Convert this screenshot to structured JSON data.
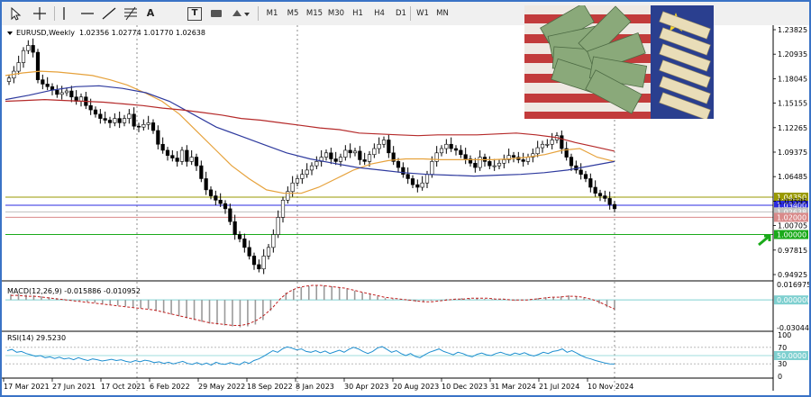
{
  "toolbar": {
    "tools": [
      "cursor",
      "crosshair",
      "vertical-line",
      "horizontal-line",
      "trendline",
      "fibonacci",
      "text",
      "label",
      "rectangle",
      "shapes"
    ],
    "text_tool_label": "A",
    "label_tool_label": "T",
    "timeframes": [
      "M1",
      "M5",
      "M15",
      "M30",
      "H1",
      "H4",
      "D1",
      "W1",
      "MN"
    ]
  },
  "chart_data": {
    "type": "candlestick",
    "symbol_header": "EURUSD,Weekly",
    "ohlc_header": "1.02356 1.02774 1.01770 1.02638",
    "price_axis_ticks": [
      "1.23825",
      "1.20935",
      "1.18045",
      "1.15155",
      "1.12265",
      "1.09375",
      "1.06485",
      "1.03595",
      "1.00705",
      "0.97815",
      "0.94925"
    ],
    "price_range": [
      0.94925,
      1.23825
    ],
    "time_axis_labels": [
      "17 Mar 2021",
      "27 Jun 2021",
      "17 Oct 2021",
      "6 Feb 2022",
      "29 May 2022",
      "18 Sep 2022",
      "8 Jan 2023",
      "30 Apr 2023",
      "20 Aug 2023",
      "10 Dec 2023",
      "31 Mar 2024",
      "21 Jul 2024",
      "10 Nov 2024"
    ],
    "price_levels": [
      {
        "label": "1.04350",
        "value": 1.0435,
        "color": "#9a9a00"
      },
      {
        "label": "1.03400",
        "value": 1.034,
        "color": "#2b2be0"
      },
      {
        "label": "1.02638",
        "value": 1.02638,
        "color": "#c0c0c0"
      },
      {
        "label": "1.02000",
        "value": 1.02,
        "color": "#d98a8a"
      },
      {
        "label": "1.00000",
        "value": 1.0,
        "color": "#1aaa1a"
      }
    ],
    "moving_averages": [
      {
        "color": "#e6a23c",
        "values": [
          1.185,
          1.188,
          1.19,
          1.189,
          1.187,
          1.185,
          1.18,
          1.174,
          1.165,
          1.155,
          1.14,
          1.12,
          1.1,
          1.08,
          1.065,
          1.052,
          1.048,
          1.048,
          1.055,
          1.065,
          1.075,
          1.082,
          1.086,
          1.088,
          1.088,
          1.087,
          1.087,
          1.087,
          1.087,
          1.088,
          1.09,
          1.093,
          1.098,
          1.1,
          1.09,
          1.085
        ]
      },
      {
        "color": "#2e3a9e",
        "values": [
          1.157,
          1.162,
          1.168,
          1.172,
          1.173,
          1.17,
          1.165,
          1.155,
          1.14,
          1.125,
          1.115,
          1.105,
          1.095,
          1.088,
          1.083,
          1.078,
          1.075,
          1.072,
          1.07,
          1.069,
          1.068,
          1.069,
          1.07,
          1.072,
          1.075,
          1.08,
          1.085
        ]
      },
      {
        "color": "#b52a2a",
        "values": [
          1.155,
          1.156,
          1.157,
          1.156,
          1.155,
          1.154,
          1.152,
          1.15,
          1.147,
          1.145,
          1.142,
          1.139,
          1.135,
          1.133,
          1.13,
          1.127,
          1.124,
          1.122,
          1.118,
          1.117,
          1.116,
          1.115,
          1.116,
          1.116,
          1.116,
          1.117,
          1.118,
          1.116,
          1.113,
          1.107,
          1.102,
          1.097
        ]
      }
    ],
    "closes": [
      1.182,
      1.19,
      1.2,
      1.214,
      1.22,
      1.212,
      1.18,
      1.175,
      1.172,
      1.168,
      1.163,
      1.165,
      1.167,
      1.16,
      1.155,
      1.16,
      1.15,
      1.145,
      1.14,
      1.135,
      1.133,
      1.13,
      1.135,
      1.13,
      1.135,
      1.14,
      1.126,
      1.125,
      1.128,
      1.13,
      1.121,
      1.105,
      1.098,
      1.092,
      1.089,
      1.085,
      1.098,
      1.085,
      1.09,
      1.08,
      1.065,
      1.052,
      1.045,
      1.04,
      1.036,
      1.03,
      1.015,
      1.0,
      0.995,
      0.985,
      0.975,
      0.965,
      0.96,
      0.975,
      0.985,
      1.0,
      1.02,
      1.04,
      1.05,
      1.06,
      1.065,
      1.07,
      1.075,
      1.08,
      1.085,
      1.09,
      1.095,
      1.088,
      1.085,
      1.09,
      1.098,
      1.095,
      1.097,
      1.087,
      1.085,
      1.093,
      1.1,
      1.105,
      1.11,
      1.095,
      1.085,
      1.078,
      1.07,
      1.065,
      1.058,
      1.055,
      1.06,
      1.07,
      1.085,
      1.095,
      1.1,
      1.105,
      1.1,
      1.098,
      1.093,
      1.088,
      1.083,
      1.078,
      1.09,
      1.085,
      1.08,
      1.08,
      1.083,
      1.087,
      1.092,
      1.09,
      1.087,
      1.085,
      1.09,
      1.094,
      1.101,
      1.105,
      1.105,
      1.11,
      1.115,
      1.1,
      1.09,
      1.08,
      1.075,
      1.07,
      1.065,
      1.055,
      1.048,
      1.045,
      1.042,
      1.035,
      1.03
    ],
    "macd": {
      "label": "MACD(12,26,9) -0.015886 -0.010952",
      "ticks": [
        "0.016975",
        "0.000000",
        "-0.030447"
      ],
      "range": [
        -0.030447,
        0.016975
      ],
      "histogram": [
        0.006,
        0.007,
        0.006,
        0.005,
        0.004,
        0.003,
        0.002,
        0.001,
        0.0,
        -0.001,
        -0.002,
        -0.003,
        -0.004,
        -0.005,
        -0.006,
        -0.007,
        -0.008,
        -0.009,
        -0.01,
        -0.012,
        -0.014,
        -0.016,
        -0.018,
        -0.02,
        -0.022,
        -0.024,
        -0.026,
        -0.027,
        -0.028,
        -0.029,
        -0.03,
        -0.029,
        -0.027,
        -0.022,
        -0.012,
        0.0,
        0.008,
        0.012,
        0.014,
        0.015,
        0.016,
        0.016,
        0.015,
        0.014,
        0.012,
        0.01,
        0.008,
        0.006,
        0.004,
        0.002,
        0.001,
        0.0,
        -0.001,
        -0.002,
        -0.002,
        -0.001,
        0.0,
        0.001,
        0.001,
        0.002,
        0.002,
        0.002,
        0.001,
        0.001,
        0.0,
        0.0,
        -0.001,
        0.0,
        0.001,
        0.002,
        0.003,
        0.003,
        0.004,
        0.005,
        0.004,
        0.002,
        0.0,
        -0.004,
        -0.008,
        -0.011
      ],
      "signal": [
        0.005,
        0.005,
        0.004,
        0.004,
        0.003,
        0.002,
        0.001,
        0.0,
        -0.001,
        -0.002,
        -0.003,
        -0.004,
        -0.005,
        -0.006,
        -0.007,
        -0.008,
        -0.009,
        -0.01,
        -0.011,
        -0.013,
        -0.015,
        -0.017,
        -0.019,
        -0.021,
        -0.023,
        -0.025,
        -0.026,
        -0.027,
        -0.028,
        -0.028,
        -0.026,
        -0.022,
        -0.016,
        -0.008,
        0.002,
        0.009,
        0.013,
        0.015,
        0.016,
        0.016,
        0.015,
        0.014,
        0.013,
        0.011,
        0.009,
        0.007,
        0.005,
        0.003,
        0.002,
        0.001,
        0.0,
        -0.001,
        -0.002,
        -0.002,
        -0.001,
        0.0,
        0.001,
        0.001,
        0.002,
        0.002,
        0.002,
        0.001,
        0.001,
        0.0,
        0.0,
        0.0,
        0.001,
        0.002,
        0.003,
        0.003,
        0.004,
        0.004,
        0.003,
        0.001,
        -0.002,
        -0.006,
        -0.01
      ]
    },
    "rsi": {
      "label": "RSI(14) 29.5230",
      "ticks": [
        "100",
        "70",
        "50.0000",
        "30",
        "0"
      ],
      "range": [
        0,
        100
      ],
      "levels": [
        70,
        50,
        30
      ],
      "values": [
        62,
        65,
        58,
        60,
        55,
        52,
        48,
        50,
        45,
        47,
        43,
        46,
        42,
        44,
        40,
        45,
        41,
        38,
        42,
        40,
        37,
        39,
        41,
        38,
        40,
        36,
        34,
        38,
        35,
        39,
        37,
        33,
        35,
        31,
        34,
        30,
        33,
        36,
        31,
        29,
        33,
        28,
        32,
        27,
        34,
        30,
        29,
        33,
        30,
        28,
        35,
        31,
        38,
        42,
        48,
        55,
        62,
        58,
        66,
        71,
        68,
        64,
        66,
        60,
        58,
        62,
        57,
        61,
        55,
        59,
        63,
        58,
        65,
        70,
        66,
        60,
        55,
        60,
        68,
        72,
        65,
        58,
        62,
        55,
        50,
        55,
        48,
        45,
        52,
        58,
        62,
        66,
        60,
        56,
        52,
        58,
        55,
        50,
        47,
        53,
        56,
        52,
        50,
        55,
        58,
        54,
        51,
        56,
        53,
        57,
        52,
        49,
        53,
        58,
        55,
        60,
        62,
        66,
        58,
        62,
        56,
        50,
        45,
        42,
        38,
        35,
        32,
        30,
        29.5
      ]
    }
  }
}
